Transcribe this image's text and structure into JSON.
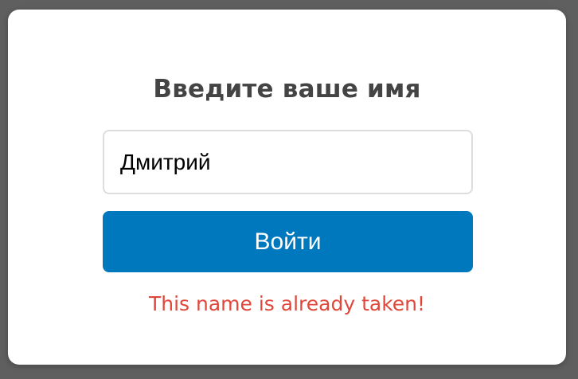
{
  "dialog": {
    "title": "Введите ваше имя",
    "name_input": {
      "value": "Дмитрий",
      "placeholder": ""
    },
    "submit_label": "Войти",
    "error_message": "This name is already taken!"
  },
  "colors": {
    "backdrop": "#5f5f5f",
    "dialog_background": "#ffffff",
    "title_text": "#444444",
    "input_border": "#dddddd",
    "button_background": "#0078be",
    "button_text": "#ffffff",
    "error_text": "#e0473b"
  }
}
